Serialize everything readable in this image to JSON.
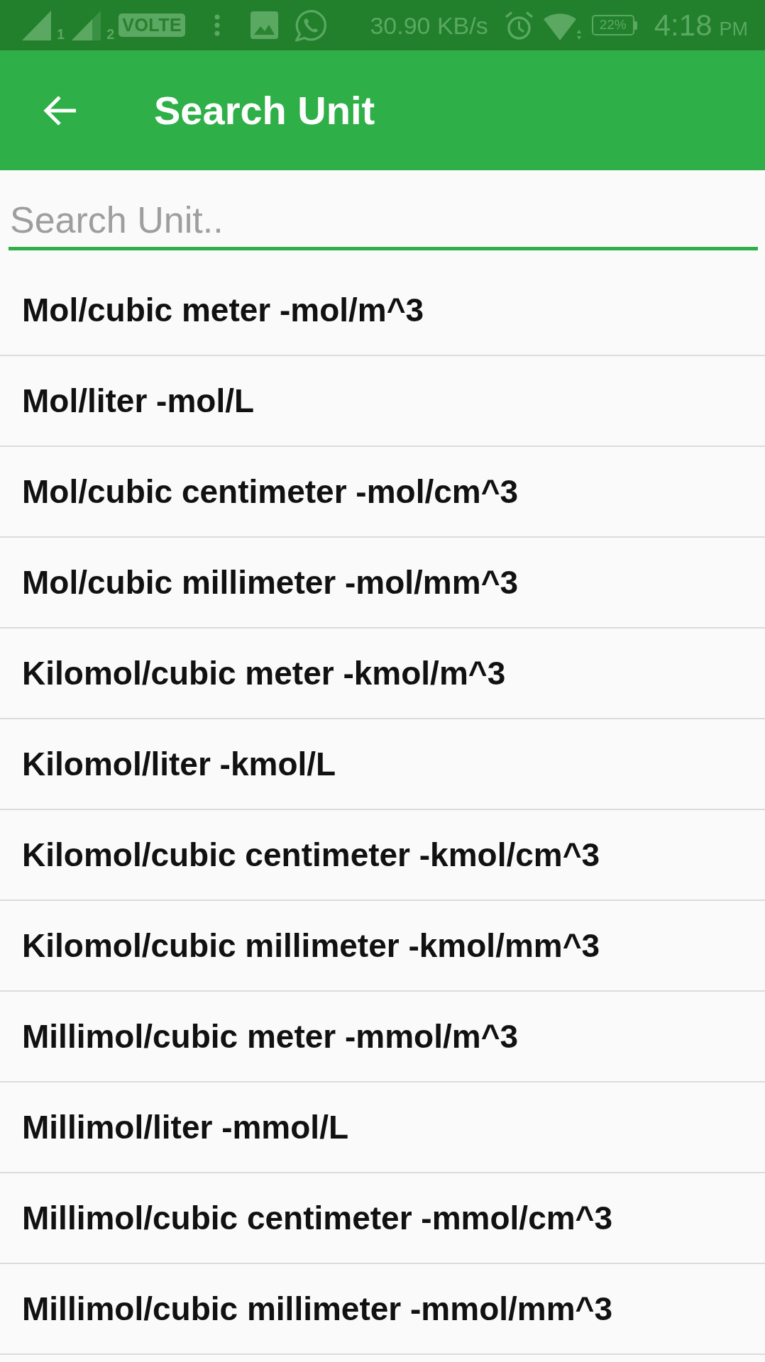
{
  "status_bar": {
    "sim_labels": [
      "1",
      "2"
    ],
    "volte": "VOLTE",
    "net_speed": "30.90 KB/s",
    "battery": "22%",
    "time": "4:18",
    "time_period": "PM"
  },
  "app_bar": {
    "title": "Search Unit"
  },
  "search": {
    "placeholder": "Search Unit.."
  },
  "units": [
    "Mol/cubic meter -mol/m^3",
    "Mol/liter -mol/L",
    "Mol/cubic centimeter -mol/cm^3",
    "Mol/cubic millimeter -mol/mm^3",
    "Kilomol/cubic meter -kmol/m^3",
    "Kilomol/liter -kmol/L",
    "Kilomol/cubic centimeter -kmol/cm^3",
    "Kilomol/cubic millimeter -kmol/mm^3",
    "Millimol/cubic meter -mmol/m^3",
    "Millimol/liter -mmol/L",
    "Millimol/cubic centimeter -mmol/cm^3",
    "Millimol/cubic millimeter -mmol/mm^3"
  ]
}
